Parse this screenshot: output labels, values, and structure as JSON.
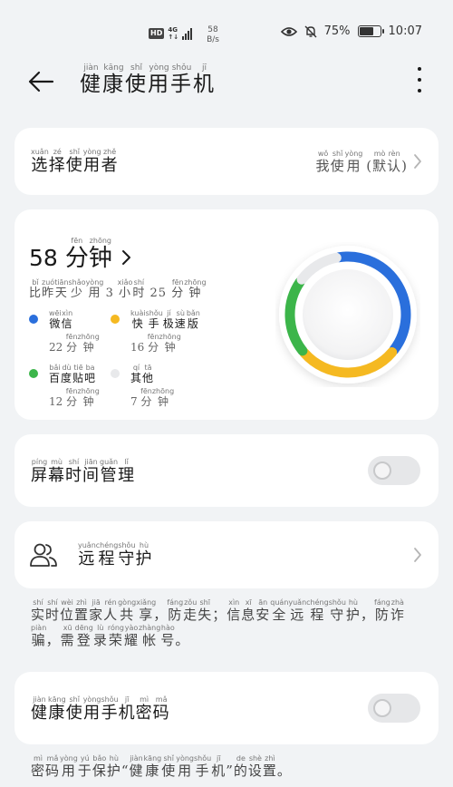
{
  "status_bar": {
    "hd": "HD",
    "network": "4G",
    "network_sub": "↑↓",
    "speed_value": "58",
    "speed_unit": "B/s",
    "battery": "75%",
    "battery_level": 0.75,
    "time": "10:07"
  },
  "app_bar": {
    "title": {
      "chars": [
        "健",
        "康",
        "使",
        "用",
        "手",
        "机"
      ],
      "pinyin": [
        "jiàn",
        "kāng",
        "shǐ",
        "yòng",
        "shǒu",
        "jī"
      ]
    }
  },
  "select_user": {
    "label": {
      "chars": [
        "选",
        "择",
        "使",
        "用",
        "者"
      ],
      "pinyin": [
        "xuǎn",
        "zé",
        "shǐ",
        "yòng",
        "zhě"
      ]
    },
    "value": {
      "chars": [
        "我",
        "使",
        "用",
        " (",
        "默",
        "认",
        ")"
      ],
      "pinyin": [
        "wǒ",
        "shǐ",
        "yòng",
        "",
        "mò",
        "rèn",
        ""
      ]
    }
  },
  "usage": {
    "total_value": "58",
    "total_unit": {
      "chars": [
        "分",
        "钟"
      ],
      "pinyin": [
        "fēn",
        "zhōng"
      ]
    },
    "compare": {
      "chars": [
        "比",
        "昨",
        "天",
        "少",
        "用",
        " 3 ",
        "小",
        "时",
        " 25 ",
        "分",
        "钟"
      ],
      "pinyin": [
        "bǐ",
        "zuó",
        "tiān",
        "shǎo",
        "yòng",
        "",
        "xiǎo",
        "shí",
        "",
        "fēn",
        "zhōng"
      ]
    },
    "apps": [
      {
        "name": {
          "chars": [
            "微",
            "信"
          ],
          "pinyin": [
            "wēi",
            "xìn"
          ]
        },
        "time": {
          "chars": [
            "22 ",
            "分",
            "钟"
          ],
          "pinyin": [
            "",
            "fēn",
            "zhōng"
          ]
        },
        "color": "#2a6fdc"
      },
      {
        "name": {
          "chars": [
            "快",
            "手",
            "极",
            "速",
            "版"
          ],
          "pinyin": [
            "kuài",
            "shǒu",
            "jí",
            "sù",
            "bǎn"
          ]
        },
        "time": {
          "chars": [
            "16 ",
            "分",
            "钟"
          ],
          "pinyin": [
            "",
            "fēn",
            "zhōng"
          ]
        },
        "color": "#f5b921"
      },
      {
        "name": {
          "chars": [
            "百",
            "度",
            "贴",
            "吧"
          ],
          "pinyin": [
            "bǎi",
            "dù",
            "tiē",
            "ba"
          ]
        },
        "time": {
          "chars": [
            "12 ",
            "分",
            "钟"
          ],
          "pinyin": [
            "",
            "fēn",
            "zhōng"
          ]
        },
        "color": "#3cb54a"
      },
      {
        "name": {
          "chars": [
            "其",
            "他"
          ],
          "pinyin": [
            "qí",
            "tā"
          ]
        },
        "time": {
          "chars": [
            "7 ",
            "分",
            "钟"
          ],
          "pinyin": [
            "",
            "fēn",
            "zhōng"
          ]
        },
        "color": "#e8e9eb"
      }
    ]
  },
  "screen_time": {
    "label": {
      "chars": [
        "屏",
        "幕",
        "时",
        "间",
        "管",
        "理"
      ],
      "pinyin": [
        "píng",
        "mù",
        "shí",
        "jiān",
        "guǎn",
        "lǐ"
      ]
    },
    "enabled": false
  },
  "remote": {
    "label": {
      "chars": [
        "远",
        "程",
        "守",
        "护"
      ],
      "pinyin": [
        "yuǎn",
        "chéng",
        "shǒu",
        "hù"
      ]
    },
    "icon": "people-icon"
  },
  "remote_desc": {
    "chars": [
      "实",
      "时",
      "位",
      "置",
      "家",
      "人",
      "共",
      "享",
      "，",
      "防",
      "走",
      "失",
      "；",
      "信",
      "息",
      "安",
      "全",
      "远",
      "程",
      "守",
      "护",
      "，",
      "防",
      "诈",
      "骗",
      "，",
      "需",
      "登",
      "录",
      "荣",
      "耀",
      "帐",
      "号",
      "。"
    ],
    "pinyin": [
      "shí",
      "shí",
      "wèi",
      "zhì",
      "jiā",
      "rén",
      "gòng",
      "xiǎng",
      "",
      "fáng",
      "zǒu",
      "shī",
      "",
      "xìn",
      "xī",
      "ān",
      "quán",
      "yuǎn",
      "chéng",
      "shǒu",
      "hù",
      "",
      "fáng",
      "zhà",
      "piàn",
      "",
      "xū",
      "dēng",
      "lù",
      "róng",
      "yào",
      "zhàng",
      "hào",
      ""
    ]
  },
  "password": {
    "label": {
      "chars": [
        "健",
        "康",
        "使",
        "用",
        "手",
        "机",
        "密",
        "码"
      ],
      "pinyin": [
        "jiàn",
        "kāng",
        "shǐ",
        "yòng",
        "shǒu",
        "jī",
        "mì",
        "mǎ"
      ]
    },
    "enabled": false
  },
  "password_desc": {
    "chars": [
      "密",
      "码",
      "用",
      "于",
      "保",
      "护",
      "“",
      "健",
      "康",
      "使",
      "用",
      "手",
      "机",
      "”",
      "的",
      "设",
      "置",
      "。"
    ],
    "pinyin": [
      "mì",
      "mǎ",
      "yòng",
      "yú",
      "bǎo",
      "hù",
      "",
      "jiàn",
      "kāng",
      "shǐ",
      "yòng",
      "shǒu",
      "jī",
      "",
      "de",
      "shè",
      "zhì",
      ""
    ]
  }
}
